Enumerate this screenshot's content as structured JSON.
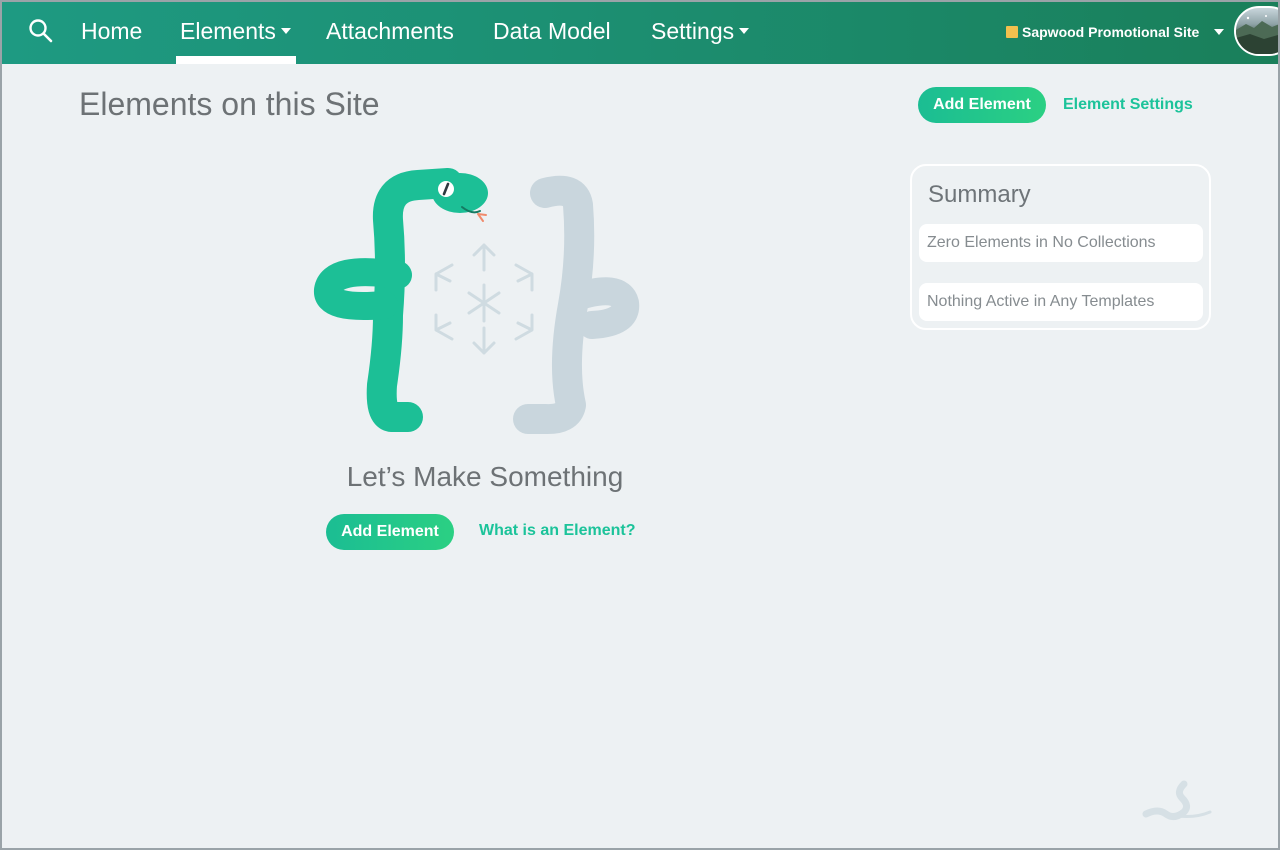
{
  "nav": {
    "search_icon": "search-icon",
    "items": [
      {
        "label": "Home"
      },
      {
        "label": "Elements",
        "active": true,
        "dropdown": true
      },
      {
        "label": "Attachments"
      },
      {
        "label": "Data Model"
      },
      {
        "label": "Settings",
        "dropdown": true
      }
    ],
    "site_name": "Sapwood Promotional Site",
    "site_color": "#f2c04e",
    "avatar_icon": "user-avatar"
  },
  "header": {
    "title": "Elements on this Site",
    "add_button": "Add Element",
    "settings_link": "Element Settings"
  },
  "summary": {
    "title": "Summary",
    "rows": [
      "Zero Elements in No Collections",
      "Nothing Active in Any Templates"
    ]
  },
  "empty_state": {
    "illustration": "snakes-and-cube-illustration",
    "heading": "Let’s Make Something",
    "add_button": "Add Element",
    "help_link": "What is an Element?"
  },
  "colors": {
    "nav_start": "#1e9a82",
    "nav_end": "#1a7f5a",
    "accent": "#1cc39a",
    "background": "#edf1f3"
  }
}
